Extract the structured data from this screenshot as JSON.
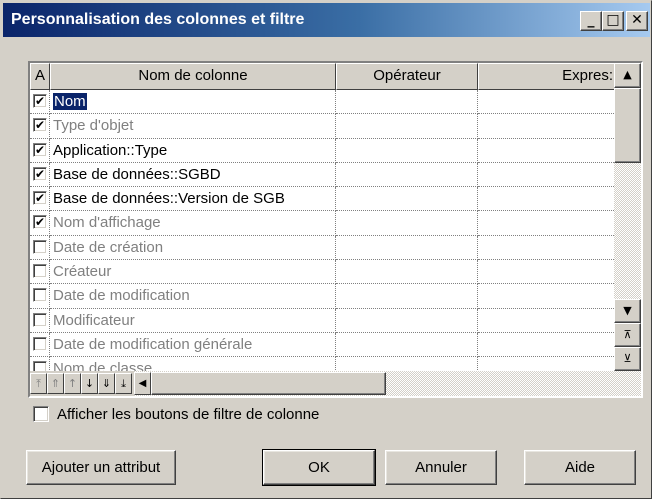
{
  "window": {
    "title": "Personnalisation des colonnes et filtre",
    "minimize_glyph": "_",
    "maximize_glyph": "□",
    "close_glyph": "✕"
  },
  "grid": {
    "headers": [
      "A",
      "Nom de colonne",
      "Opérateur",
      "Expres:"
    ],
    "rows": [
      {
        "checked": true,
        "name": "Nom",
        "enabled": true,
        "selected": true
      },
      {
        "checked": true,
        "name": "Type d'objet",
        "enabled": false,
        "selected": false
      },
      {
        "checked": true,
        "name": "Application::Type",
        "enabled": true,
        "selected": false
      },
      {
        "checked": true,
        "name": "Base de données::SGBD",
        "enabled": true,
        "selected": false
      },
      {
        "checked": true,
        "name": "Base de données::Version de SGB",
        "enabled": true,
        "selected": false
      },
      {
        "checked": true,
        "name": "Nom d'affichage",
        "enabled": false,
        "selected": false
      },
      {
        "checked": false,
        "name": "Date de création",
        "enabled": false,
        "selected": false
      },
      {
        "checked": false,
        "name": "Créateur",
        "enabled": false,
        "selected": false
      },
      {
        "checked": false,
        "name": "Date de modification",
        "enabled": false,
        "selected": false
      },
      {
        "checked": false,
        "name": "Modificateur",
        "enabled": false,
        "selected": false
      },
      {
        "checked": false,
        "name": "Date de modification générale",
        "enabled": false,
        "selected": false
      },
      {
        "checked": false,
        "name": "Nom de classe",
        "enabled": false,
        "selected": false
      }
    ],
    "check_glyph": "✔"
  },
  "toolbar": {
    "nav_buttons": [
      {
        "glyph": "⤒",
        "enabled": false
      },
      {
        "glyph": "⇑",
        "enabled": false
      },
      {
        "glyph": "↑",
        "enabled": false
      },
      {
        "glyph": "↓",
        "enabled": true
      },
      {
        "glyph": "⇓",
        "enabled": true
      },
      {
        "glyph": "⤓",
        "enabled": true
      }
    ]
  },
  "filter_checkbox": {
    "label": "Afficher les boutons de filtre de colonne",
    "checked": false
  },
  "buttons": {
    "add_attribute": "Ajouter un attribut",
    "ok": "OK",
    "cancel": "Annuler",
    "help": "Aide"
  }
}
